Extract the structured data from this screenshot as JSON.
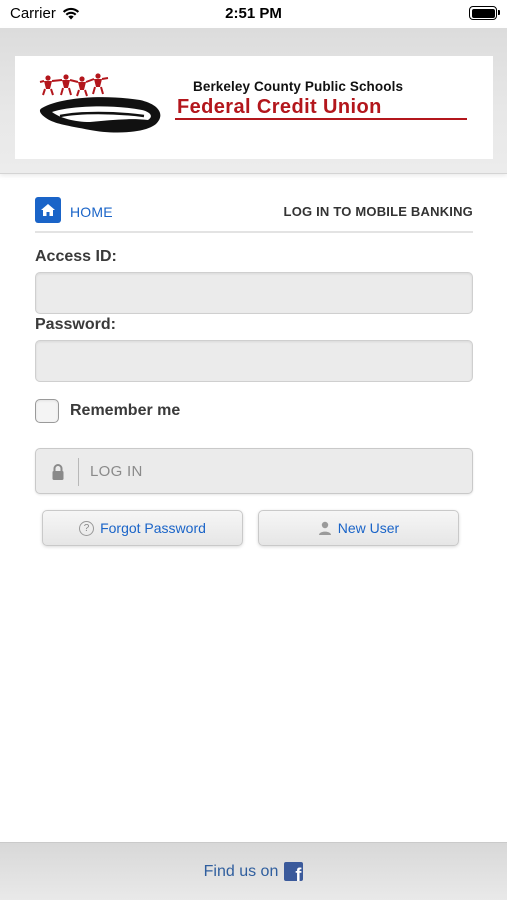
{
  "status_bar": {
    "carrier": "Carrier",
    "time": "2:51 PM"
  },
  "logo": {
    "line1": "Berkeley County Public Schools",
    "line2": "Federal Credit Union",
    "brand_color": "#b3161c"
  },
  "nav": {
    "home_label": "HOME",
    "title": "LOG IN TO MOBILE BANKING",
    "home_icon": "home-icon",
    "accent_color": "#1a64c8"
  },
  "form": {
    "access_id_label": "Access ID:",
    "access_id_value": "",
    "password_label": "Password:",
    "password_value": "",
    "remember_label": "Remember me",
    "remember_checked": false,
    "login_label": "LOG IN",
    "login_icon": "lock-icon"
  },
  "actions": {
    "forgot_label": "Forgot Password",
    "forgot_icon": "question-circle-icon",
    "new_user_label": "New User",
    "new_user_icon": "user-icon"
  },
  "footer": {
    "text": "Find us on",
    "icon": "facebook-icon",
    "link_color": "#2f5e9e"
  }
}
